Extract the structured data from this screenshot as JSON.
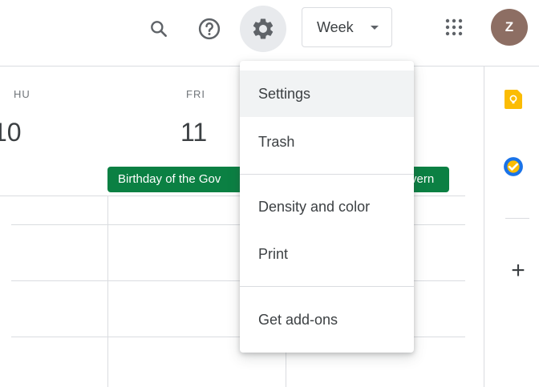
{
  "header": {
    "view_select": {
      "label": "Week"
    },
    "avatar": {
      "initial": "Z",
      "color": "#8d6e63"
    }
  },
  "days": [
    {
      "name": "HU",
      "number": "10"
    },
    {
      "name": "FRI",
      "number": "11"
    }
  ],
  "events": [
    {
      "title_left": "Birthday of the Gov",
      "title_right": "vern",
      "color": "#0b8043"
    }
  ],
  "settings_menu": {
    "items": [
      {
        "label": "Settings"
      },
      {
        "label": "Trash"
      },
      {
        "label": "Density and color"
      },
      {
        "label": "Print"
      },
      {
        "label": "Get add-ons"
      }
    ]
  },
  "side_panel": {
    "add_label": "+"
  }
}
